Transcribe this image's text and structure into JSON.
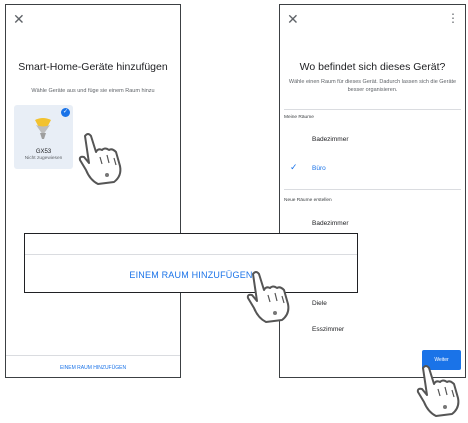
{
  "left_screen": {
    "close_icon": "close-icon",
    "title": "Smart-Home-Geräte hinzufügen",
    "subtitle": "Wähle Geräte aus und füge sie einem Raum hinzu",
    "device": {
      "name": "GX53",
      "status": "Nicht zugewiesen",
      "selected": true,
      "icon": "lightbulb-icon"
    },
    "footer_button": "EINEM RAUM HINZUFÜGEN"
  },
  "banner": {
    "label": "EINEM RAUM HINZUFÜGEN"
  },
  "right_screen": {
    "close_icon": "close-icon",
    "more_icon": "more-vert-icon",
    "title": "Wo befindet sich dieses Gerät?",
    "subtitle": "Wähle einen Raum für dieses Gerät. Dadurch lassen sich die Geräte besser organisieren.",
    "my_rooms_label": "Meine Räume",
    "my_rooms": [
      {
        "label": "Badezimmer",
        "selected": false
      },
      {
        "label": "Büro",
        "selected": true
      }
    ],
    "new_rooms_label": "Neue Räume erstellen",
    "new_rooms": [
      "Badezimmer",
      "Diele",
      "Esszimmer"
    ],
    "next_button": "Weiter"
  },
  "colors": {
    "accent": "#1a73e8",
    "card_bg": "#e8eef6",
    "bulb_yellow": "#f2c230",
    "bulb_gray": "#9e9e9e"
  }
}
